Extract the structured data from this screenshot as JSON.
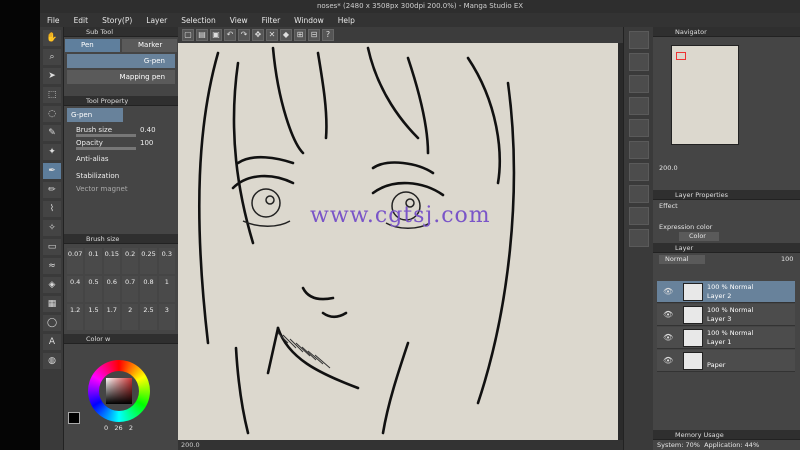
{
  "window": {
    "title": "noses* (2480 x 3508px 300dpi 200.0%) - Manga Studio EX"
  },
  "menu": [
    "File",
    "Edit",
    "Story(P)",
    "Layer",
    "Selection",
    "View",
    "Filter",
    "Window",
    "Help"
  ],
  "sub_tool": {
    "header": "Sub Tool",
    "tabs": [
      "Pen",
      "Marker"
    ],
    "brushes": [
      "G-pen",
      "Mapping pen"
    ]
  },
  "tool_property": {
    "header": "Tool Property",
    "current": "G-pen",
    "brush_size_label": "Brush size",
    "brush_size_value": "0.40",
    "opacity_label": "Opacity",
    "opacity_value": "100",
    "antialias_label": "Anti-alias",
    "stabilization_label": "Stabilization",
    "vector_magnet_label": "Vector magnet"
  },
  "brush_size_panel": {
    "header": "Brush size",
    "sizes": [
      "0.07",
      "0.1",
      "0.15",
      "0.2",
      "0.25",
      "0.3",
      "0.4",
      "0.5",
      "0.6",
      "0.7",
      "0.8",
      "1",
      "1.2",
      "1.5",
      "1.7",
      "2",
      "2.5",
      "3"
    ]
  },
  "color_panel": {
    "header": "Color w",
    "values": [
      "0",
      "26",
      "2"
    ]
  },
  "canvas": {
    "tab": "noses*",
    "zoom_status": "200.0"
  },
  "watermark": "www.cgtsj.com",
  "navigator": {
    "header": "Navigator",
    "zoom": "200.0"
  },
  "layer_property": {
    "header": "Layer Properties",
    "effect_label": "Effect",
    "expression_label": "Expression color",
    "expression_value": "Color"
  },
  "layer_panel": {
    "header": "Layer",
    "blend": "Normal",
    "opacity": "100",
    "layers": [
      {
        "line1": "100 %  Normal",
        "line2": "Layer 2"
      },
      {
        "line1": "100 %  Normal",
        "line2": "Layer 3"
      },
      {
        "line1": "100 %  Normal",
        "line2": "Layer 1"
      },
      {
        "line1": "",
        "line2": "Paper"
      }
    ]
  },
  "memory": {
    "header": "Memory Usage",
    "system": "System: 70%",
    "application": "Application: 44%"
  }
}
